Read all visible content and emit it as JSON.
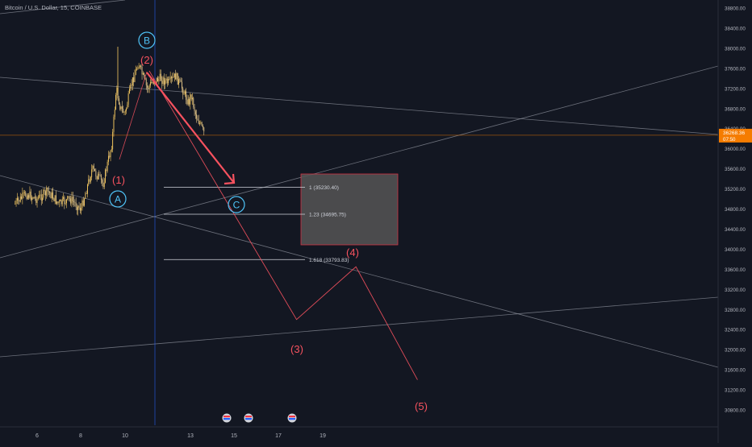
{
  "header": {
    "title": "Bitcoin / U.S. Dollar, 15, COINBASE"
  },
  "colors": {
    "background": "#131722",
    "candle_up": "#f6c85f",
    "candle_down": "#e8c98a",
    "accent": "#f7525f",
    "wave_blue": "#4fc3f7",
    "price_tag": "#f57c00",
    "trendline": "#8a8e99",
    "vertical_line": "#2962ff",
    "fib_box": "#555555",
    "fib_box_border": "#f23645"
  },
  "price_axis": {
    "ticks": [
      "38800.00",
      "38400.00",
      "38000.00",
      "37600.00",
      "37200.00",
      "36800.00",
      "36400.00",
      "36000.00",
      "35600.00",
      "35200.00",
      "34800.00",
      "34400.00",
      "34000.00",
      "33600.00",
      "33200.00",
      "32800.00",
      "32400.00",
      "32000.00",
      "31600.00",
      "31200.00",
      "30800.00"
    ],
    "current_price": "36268.36",
    "countdown": "07:50"
  },
  "time_axis": {
    "ticks": [
      "6",
      "8",
      "10",
      "13",
      "15",
      "17",
      "19"
    ]
  },
  "fib_levels": [
    {
      "label": "1 (35230.40)",
      "price": 35230.4
    },
    {
      "label": "1.23 (34695.75)",
      "price": 34695.75
    },
    {
      "label": "1.618 (33793.83)",
      "price": 33793.83
    }
  ],
  "wave_labels": {
    "wave_1": "(1)",
    "wave_2": "(2)",
    "wave_3": "(3)",
    "wave_4": "(4)",
    "wave_5": "(5)",
    "wave_a": "A",
    "wave_b": "B",
    "wave_c": "C"
  },
  "chart_data": {
    "type": "line",
    "title": "Bitcoin / U.S. Dollar, 15, COINBASE",
    "xlabel": "",
    "ylabel": "",
    "ylim": [
      30600,
      39000
    ],
    "x_ticks": [
      "6",
      "8",
      "10",
      "13",
      "15",
      "17",
      "19"
    ],
    "series": [
      {
        "x": [
          "5",
          "5.5",
          "6",
          "6.5",
          "7",
          "7.5",
          "8",
          "8.5",
          "9",
          "9.2",
          "9.4",
          "9.6",
          "9.8",
          "10",
          "10.3",
          "10.6",
          "11",
          "11.3",
          "11.6",
          "12",
          "12.3",
          "12.6",
          "12.9",
          "13",
          "13.2",
          "13.4",
          "13.6"
        ],
        "values": [
          34900,
          35100,
          35000,
          35150,
          34900,
          35000,
          34800,
          35600,
          35300,
          35700,
          36100,
          37200,
          36800,
          36700,
          37300,
          37700,
          37200,
          37350,
          37400,
          37300,
          37450,
          37200,
          36900,
          37100,
          36700,
          36500,
          36300
        ]
      },
      {
        "x": [
          "11.1",
          "17.8",
          "20.5",
          "23.3"
        ],
        "values": [
          37550,
          32600,
          33650,
          31400
        ]
      }
    ],
    "grid": false,
    "legend": "none"
  }
}
